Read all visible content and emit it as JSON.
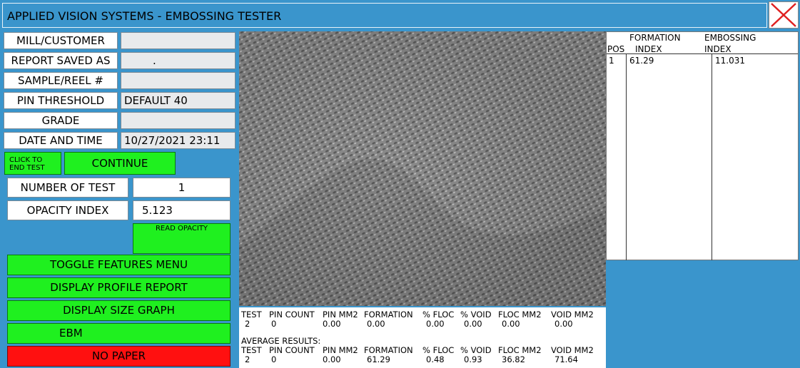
{
  "window": {
    "title": "APPLIED VISION SYSTEMS - EMBOSSING TESTER"
  },
  "colors": {
    "background": "#3a95cc",
    "button_green": "#1ff01f",
    "button_red": "#ff1010",
    "close_x": "#e02020"
  },
  "form": {
    "mill_customer": {
      "label": "MILL/CUSTOMER",
      "value": ""
    },
    "report_saved_as": {
      "label": "REPORT SAVED AS",
      "value": "."
    },
    "sample_reel": {
      "label": "SAMPLE/REEL #",
      "value": ""
    },
    "pin_threshold": {
      "label": "PIN THRESHOLD",
      "value": "DEFAULT 40"
    },
    "grade": {
      "label": "GRADE",
      "value": ""
    },
    "date_time": {
      "label": "DATE AND TIME",
      "value": "10/27/2021 23:11"
    }
  },
  "controls": {
    "click_to_end_line1": "CLICK TO",
    "click_to_end_line2": "END TEST",
    "continue": "CONTINUE",
    "number_of_test_label": "NUMBER OF TEST",
    "number_of_test_value": "1",
    "opacity_index_label": "OPACITY INDEX",
    "opacity_index_value": "5.123",
    "read_opacity": "READ OPACITY",
    "toggle_features_menu": "TOGGLE FEATURES MENU",
    "display_profile_report": "DISPLAY PROFILE REPORT",
    "display_size_graph": "DISPLAY SIZE GRAPH",
    "ebm": "EBM",
    "no_paper": "NO PAPER"
  },
  "index_table": {
    "headers": {
      "pos": "POS",
      "formation_1": "FORMATION",
      "formation_2": "INDEX",
      "embossing_1": "EMBOSSING",
      "embossing_2": "INDEX"
    },
    "rows": [
      {
        "pos": "1",
        "formation": "61.29",
        "embossing": "11.031"
      }
    ]
  },
  "results": {
    "headers": [
      "TEST",
      "PIN COUNT",
      "PIN MM2",
      "FORMATION",
      "% FLOC",
      "% VOID",
      "FLOC MM2",
      "VOID MM2"
    ],
    "current": [
      "2",
      "0",
      "0.00",
      "0.00",
      "0.00",
      "0.00",
      "0.00",
      "0.00"
    ],
    "average_label": "AVERAGE RESULTS:",
    "average_headers": [
      "TEST",
      "PIN COUNT",
      "PIN MM2",
      "FORMATION",
      "% FLOC",
      "% VOID",
      "FLOC MM2",
      "VOID MM2"
    ],
    "average": [
      "2",
      "0",
      "0.00",
      "61.29",
      "0.48",
      "0.93",
      "36.82",
      "71.64"
    ]
  }
}
